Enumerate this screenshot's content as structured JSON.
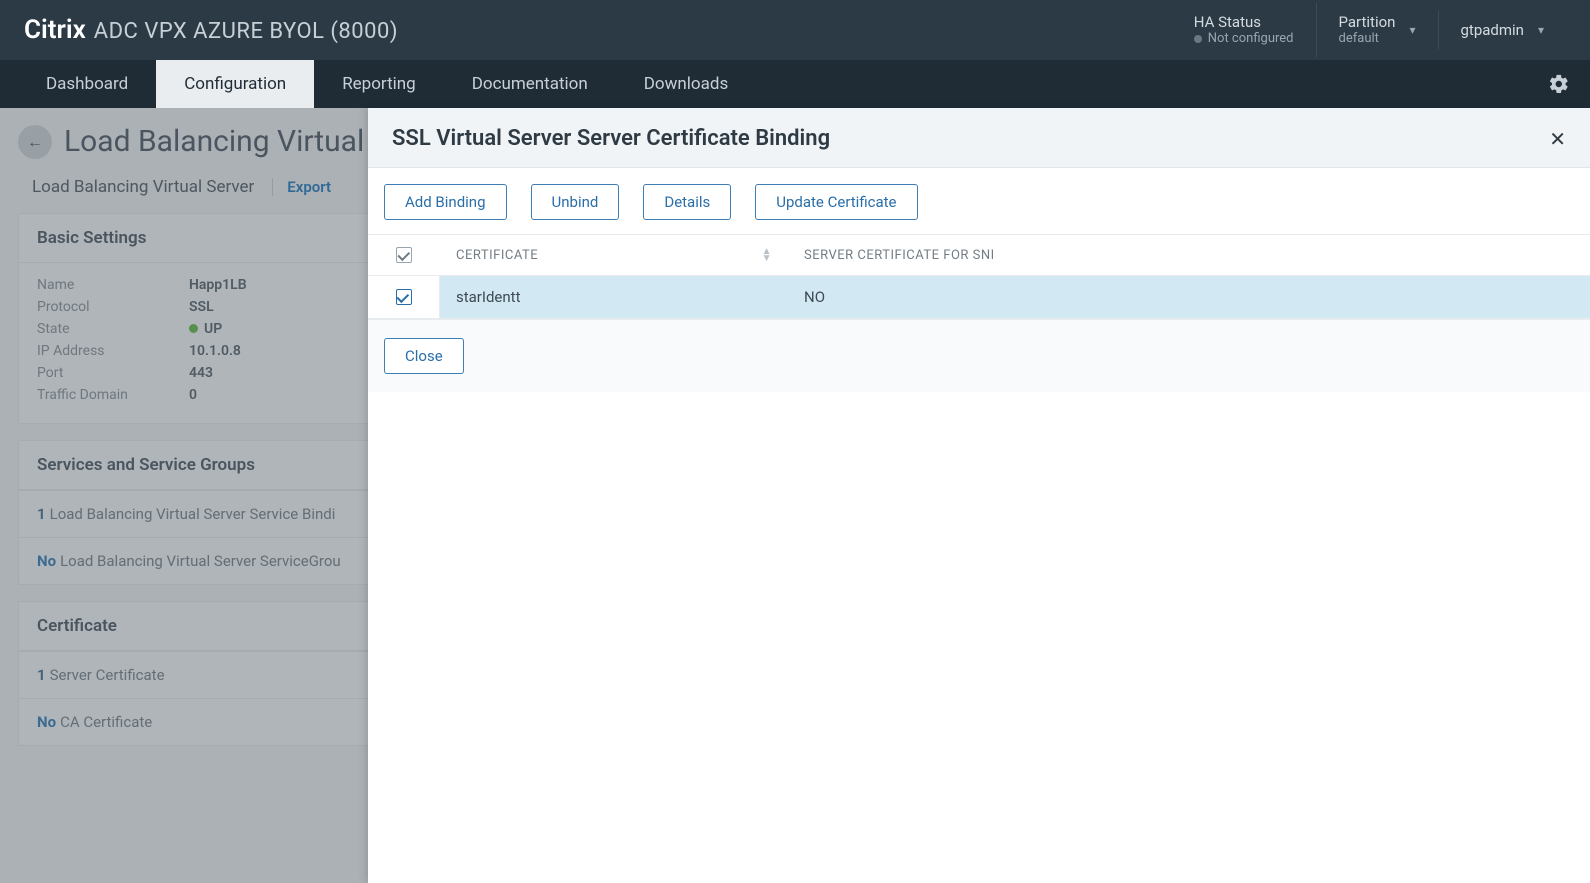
{
  "topbar": {
    "brand": "Citrix",
    "product": "ADC VPX AZURE BYOL (8000)",
    "ha_label": "HA Status",
    "ha_value": "Not configured",
    "partition_label": "Partition",
    "partition_value": "default",
    "user": "gtpadmin"
  },
  "nav": {
    "tabs": [
      "Dashboard",
      "Configuration",
      "Reporting",
      "Documentation",
      "Downloads"
    ],
    "active_index": 1
  },
  "page": {
    "title": "Load Balancing Virtual",
    "breadcrumb": "Load Balancing Virtual Server",
    "export_link": "Export",
    "basic_settings": {
      "heading": "Basic Settings",
      "rows": [
        {
          "key": "Name",
          "value": "Happ1LB"
        },
        {
          "key": "Protocol",
          "value": "SSL"
        },
        {
          "key": "State",
          "value": "UP",
          "status": true
        },
        {
          "key": "IP Address",
          "value": "10.1.0.8"
        },
        {
          "key": "Port",
          "value": "443"
        },
        {
          "key": "Traffic Domain",
          "value": "0"
        }
      ]
    },
    "services": {
      "heading": "Services and Service Groups",
      "rows": [
        {
          "count": "1",
          "text": "Load Balancing Virtual Server Service Bindi"
        },
        {
          "no": "No",
          "text": "Load Balancing Virtual Server ServiceGrou"
        }
      ]
    },
    "certificate": {
      "heading": "Certificate",
      "rows": [
        {
          "count": "1",
          "text": "Server Certificate"
        },
        {
          "no": "No",
          "text": "CA Certificate"
        }
      ]
    }
  },
  "modal": {
    "title": "SSL Virtual Server Server Certificate Binding",
    "buttons": {
      "add_binding": "Add Binding",
      "unbind": "Unbind",
      "details": "Details",
      "update_cert": "Update Certificate",
      "close": "Close"
    },
    "columns": {
      "certificate": "CERTIFICATE",
      "sni": "SERVER CERTIFICATE FOR SNI"
    },
    "rows": [
      {
        "certificate": "starIdentt",
        "sni": "NO",
        "checked": true
      }
    ]
  }
}
